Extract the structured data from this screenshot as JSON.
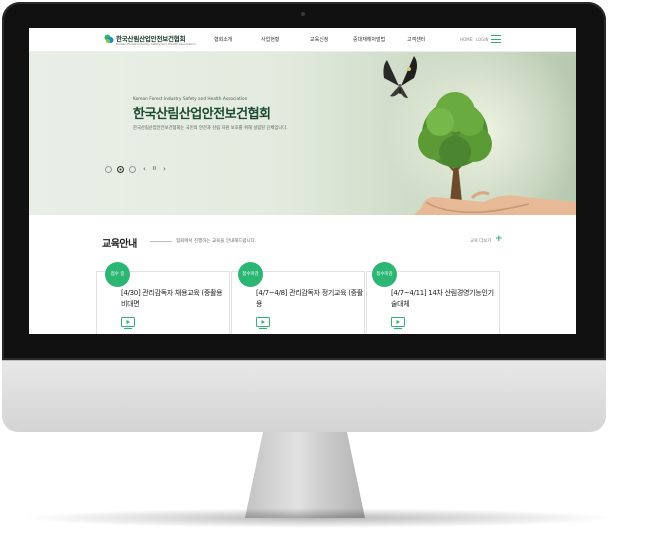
{
  "header": {
    "logo_text": "한국산림산업안전보건협회",
    "logo_sub": "Korean Forest Industry Safety and Health Association",
    "nav": [
      "협회소개",
      "사업현황",
      "교육신청",
      "중대재해처벌법",
      "고객센터"
    ],
    "util_home": "HOME",
    "util_sep": "|",
    "util_login": "LOGIN"
  },
  "hero": {
    "kicker": "Korean Forest Industry Safety and Health Association",
    "title": "한국산림산업안전보건협회",
    "description": "한국산림산업안전보건협회는 국민의 안전과 산림 자원 보호를 위해 설립된 단체입니다.",
    "prev": "‹",
    "pause": "II",
    "next": "›",
    "active_slide": 2
  },
  "education": {
    "title": "교육안내",
    "description": "협회에서 진행하는 교육을 안내해드립니다.",
    "more_label": "교육 더보기",
    "more_plus": "+",
    "cards": [
      {
        "badge": "접수 중",
        "title": "[4/30] 관리감독자 채용교육 (중촬용 비대면"
      },
      {
        "badge": "접수마감",
        "title": "[4/7~4/8] 관리감독자 정기교육 (중촬용"
      },
      {
        "badge": "접수마감",
        "title": "[4/7~4/11] 14차 산림경영기능인기술대체"
      }
    ]
  },
  "colors": {
    "accent": "#2bb673",
    "brand_dark": "#1a4a30"
  },
  "icons": [
    "logo-leaf-icon",
    "menu-icon",
    "play-video-icon",
    "butterfly-icon",
    "tree-icon",
    "hand-icon"
  ]
}
